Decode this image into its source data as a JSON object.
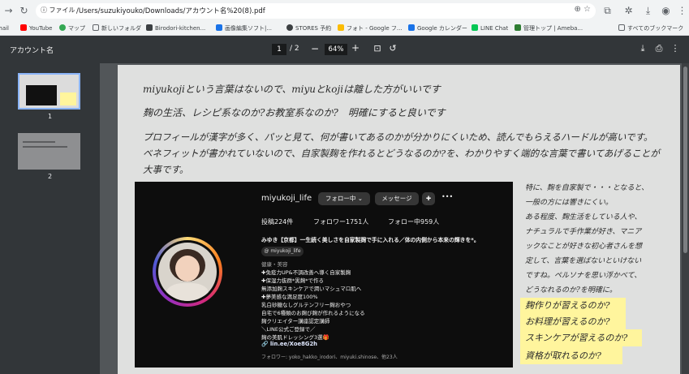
{
  "browser": {
    "site_chip": "ファイル",
    "url": "/Users/suzukiyouko/Downloads/アカウント名%20(8).pdf",
    "omni_icons": "⊕ ☆"
  },
  "bookmarks": [
    {
      "label": "mail",
      "color": "#1a73e8"
    },
    {
      "label": "YouTube",
      "color": "#ff0000"
    },
    {
      "label": "マップ",
      "color": "#34a853"
    },
    {
      "label": "新しいフォルダ",
      "color": "#5f6368"
    },
    {
      "label": "Birodori-kitchen...",
      "color": "#3c4043"
    },
    {
      "label": "画像編集ソフト|...",
      "color": "#1a73e8"
    },
    {
      "label": "STORES 予約",
      "color": "#3c4043"
    },
    {
      "label": "フォト - Google フ...",
      "color": "#fbbc04"
    },
    {
      "label": "Google カレンダー",
      "color": "#1a73e8"
    },
    {
      "label": "LINE Chat",
      "color": "#06c755"
    },
    {
      "label": "管理トップ | Ameba...",
      "color": "#2e7d32"
    },
    {
      "label": "すべてのブックマーク",
      "color": "#5f6368"
    }
  ],
  "pdf": {
    "title": "アカウント名",
    "current_page": "1",
    "page_total": "/ 2",
    "zoom": "64%",
    "thumbs": [
      "1",
      "2"
    ]
  },
  "notes": {
    "line1": "miyukojiという言葉はないので、miyuとkojiは離した方がいいです",
    "line2": "麹の生活、レシピ系なのか?お教室系なのか?　明確にすると良いです",
    "line3a": "プロフィールが漢字が多く、パッと見て、何が書いてあるのかが分かりにくいため、読んでもらえるハードルが高いです。",
    "line3b": "ベネフィットが書かれていないので、自家製麹を作れるとどうなるのか?を、わかりやすく端的な言葉で書いてあげることが",
    "line3c": "大事です。",
    "right": [
      "特に、麹を自家製で・・・となると、",
      "一般の方には響きにくい。",
      "ある程度、麹生活をしている人や、",
      "ナチュラルで手作業が好き、マニア",
      "ックなことが好きな初心者さんを想",
      "定して、言葉を選ばないといけない",
      "ですね。ペルソナを思い浮かべて、",
      "どうなれるのか?を明確に。"
    ],
    "highlights": [
      "麹作りが習えるのか?",
      "お料理が習えるのか?",
      "スキンケアが習えるのか?",
      "資格が取れるのか?"
    ],
    "highlight_color": "#fff59d"
  },
  "insta": {
    "username": "miyukoji_life",
    "follow_btn": "フォロー中 ⌄",
    "message_btn": "メッセージ",
    "more": "•••",
    "posts": "投稿224件",
    "followers": "フォロワー1751人",
    "following": "フォロー中959人",
    "name_line": "みゆき【京都】一生続く美しさを自家製麹で手に入れる／体の内側から本来の輝きを*。",
    "threads": "@ miyukoji_life",
    "bio": [
      "健康・美容",
      "✚免疫力UP&不調改善へ導く自家製麹",
      "✚保湿力抜群*黒麹*で作る",
      "無添加麹スキンケアで潤いマシュマロ肌へ",
      "✚夢美感な満足度100%",
      "乳白砂糖なしグルテンフリー麹おやつ",
      "自宅で6種類のお麹び麹が作れるようになる",
      "麹クリエイター講座認定講師",
      "＼LINE公式ご登録で／",
      "麹の美肌ドレッシング3選🎁"
    ],
    "link": "🔗 lin.ee/Xoe8G2h",
    "followed_by": "フォロワー: yoko_hakko_irodori、miyuki.shinose、他23人",
    "ring_color": "#dd2a7b"
  }
}
